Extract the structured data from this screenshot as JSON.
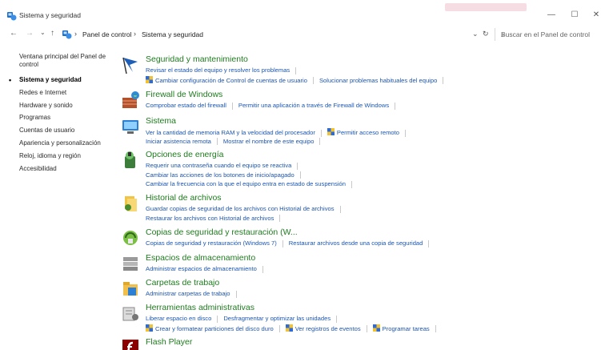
{
  "window": {
    "title": "Sistema y seguridad",
    "minimize": "—",
    "maximize": "☐",
    "close": "✕"
  },
  "nav": {
    "back": "←",
    "forward": "→",
    "recent": "⌄",
    "up": "↑",
    "breadcrumb": [
      "Panel de control",
      "Sistema y seguridad"
    ],
    "breadcrumb_sep": "›",
    "dropdown": "⌄",
    "refresh": "↻",
    "search_placeholder": "Buscar en el Panel de control"
  },
  "sidebar": {
    "items": [
      {
        "label": "Ventana principal del Panel de control",
        "current": false
      },
      {
        "label": "Sistema y seguridad",
        "current": true
      },
      {
        "label": "Redes e Internet",
        "current": false
      },
      {
        "label": "Hardware y sonido",
        "current": false
      },
      {
        "label": "Programas",
        "current": false
      },
      {
        "label": "Cuentas de usuario",
        "current": false
      },
      {
        "label": "Apariencia y personalización",
        "current": false
      },
      {
        "label": "Reloj, idioma y región",
        "current": false
      },
      {
        "label": "Accesibilidad",
        "current": false
      }
    ]
  },
  "categories": [
    {
      "icon": "flag-icon",
      "title": "Seguridad y mantenimiento",
      "lines": [
        [
          {
            "text": "Revisar el estado del equipo y resolver los problemas",
            "shield": false
          }
        ],
        [
          {
            "text": "Cambiar configuración de Control de cuentas de usuario",
            "shield": true
          },
          {
            "text": "Solucionar problemas habituales del equipo",
            "shield": false
          }
        ]
      ]
    },
    {
      "icon": "firewall-icon",
      "title": "Firewall de Windows",
      "lines": [
        [
          {
            "text": "Comprobar estado del firewall",
            "shield": false
          },
          {
            "text": "Permitir una aplicación a través de Firewall de Windows",
            "shield": false
          }
        ]
      ]
    },
    {
      "icon": "computer-icon",
      "title": "Sistema",
      "lines": [
        [
          {
            "text": "Ver la cantidad de memoria RAM y la velocidad del procesador",
            "shield": false
          },
          {
            "text": "Permitir acceso remoto",
            "shield": true
          }
        ],
        [
          {
            "text": "Iniciar asistencia remota",
            "shield": false
          },
          {
            "text": "Mostrar el nombre de este equipo",
            "shield": false
          }
        ]
      ]
    },
    {
      "icon": "power-options-icon",
      "title": "Opciones de energía",
      "lines": [
        [
          {
            "text": "Requerir una contraseña cuando el equipo se reactiva",
            "shield": false
          }
        ],
        [
          {
            "text": "Cambiar las acciones de los botones de inicio/apagado",
            "shield": false
          }
        ],
        [
          {
            "text": "Cambiar la frecuencia con la que el equipo entra en estado de suspensión",
            "shield": false
          }
        ]
      ]
    },
    {
      "icon": "file-history-icon",
      "title": "Historial de archivos",
      "lines": [
        [
          {
            "text": "Guardar copias de seguridad de los archivos con Historial de archivos",
            "shield": false
          }
        ],
        [
          {
            "text": "Restaurar los archivos con Historial de archivos",
            "shield": false
          }
        ]
      ]
    },
    {
      "icon": "backup-restore-icon",
      "title": "Copias de seguridad y restauración (W...",
      "lines": [
        [
          {
            "text": "Copias de seguridad y restauración (Windows 7)",
            "shield": false
          },
          {
            "text": "Restaurar archivos desde una copia de seguridad",
            "shield": false
          }
        ]
      ]
    },
    {
      "icon": "storage-spaces-icon",
      "title": "Espacios de almacenamiento",
      "lines": [
        [
          {
            "text": "Administrar espacios de almacenamiento",
            "shield": false
          }
        ]
      ]
    },
    {
      "icon": "work-folders-icon",
      "title": "Carpetas de trabajo",
      "lines": [
        [
          {
            "text": "Administrar carpetas de trabajo",
            "shield": false
          }
        ]
      ]
    },
    {
      "icon": "admin-tools-icon",
      "title": "Herramientas administrativas",
      "lines": [
        [
          {
            "text": "Liberar espacio en disco",
            "shield": false
          },
          {
            "text": "Desfragmentar y optimizar las unidades",
            "shield": false
          }
        ],
        [
          {
            "text": "Crear y formatear particiones del disco duro",
            "shield": true
          },
          {
            "text": "Ver registros de eventos",
            "shield": true
          },
          {
            "text": "Programar tareas",
            "shield": true
          }
        ]
      ]
    },
    {
      "icon": "flash-player-icon",
      "title": "Flash Player",
      "lines": []
    }
  ]
}
